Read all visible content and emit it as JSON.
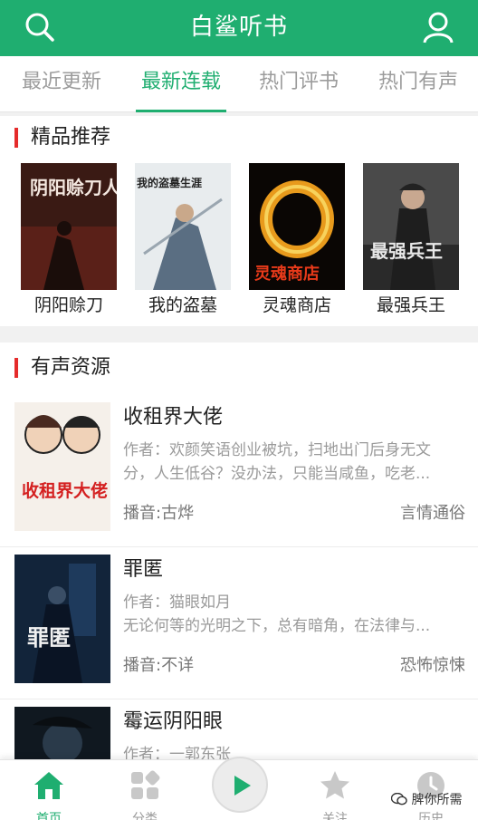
{
  "header": {
    "title": "白鲨听书"
  },
  "tabs": [
    "最近更新",
    "最新连载",
    "热门评书",
    "热门有声"
  ],
  "featured": {
    "title": "精品推荐",
    "books": [
      {
        "name": "阴阳赊刀",
        "cover_text": "阴阳赊刀人"
      },
      {
        "name": "我的盗墓",
        "cover_text": "我的盗墓生涯"
      },
      {
        "name": "灵魂商店",
        "cover_text": "灵魂商店"
      },
      {
        "name": "最强兵王",
        "cover_text": "最强兵王"
      }
    ]
  },
  "audio": {
    "title": "有声资源",
    "items": [
      {
        "title": "收租界大佬",
        "desc1": "作者：欢颜笑语创业被坑，扫地出门后身无文",
        "desc2": "分，人生低谷？没办法，只能当咸鱼，吃老...",
        "narrator": "播音:古烨",
        "category": "言情通俗",
        "cover_text": "收租界大佬"
      },
      {
        "title": "罪匿",
        "desc1": "作者：猫眼如月",
        "desc2": "无论何等的光明之下，总有暗角，在法律与...",
        "narrator": "播音:不详",
        "category": "恐怖惊悚",
        "cover_text": "罪匿"
      },
      {
        "title": "霉运阴阳眼",
        "desc1": "作者：一郭东张",
        "desc2": "",
        "narrator": "",
        "category": "",
        "cover_text": ""
      }
    ]
  },
  "nav": {
    "home": "首页",
    "category": "分类",
    "follow": "关注",
    "history": "历史"
  },
  "watermark": "脾你所需",
  "colors": {
    "brand": "#1fae70",
    "accent_bar": "#e52b2b"
  }
}
